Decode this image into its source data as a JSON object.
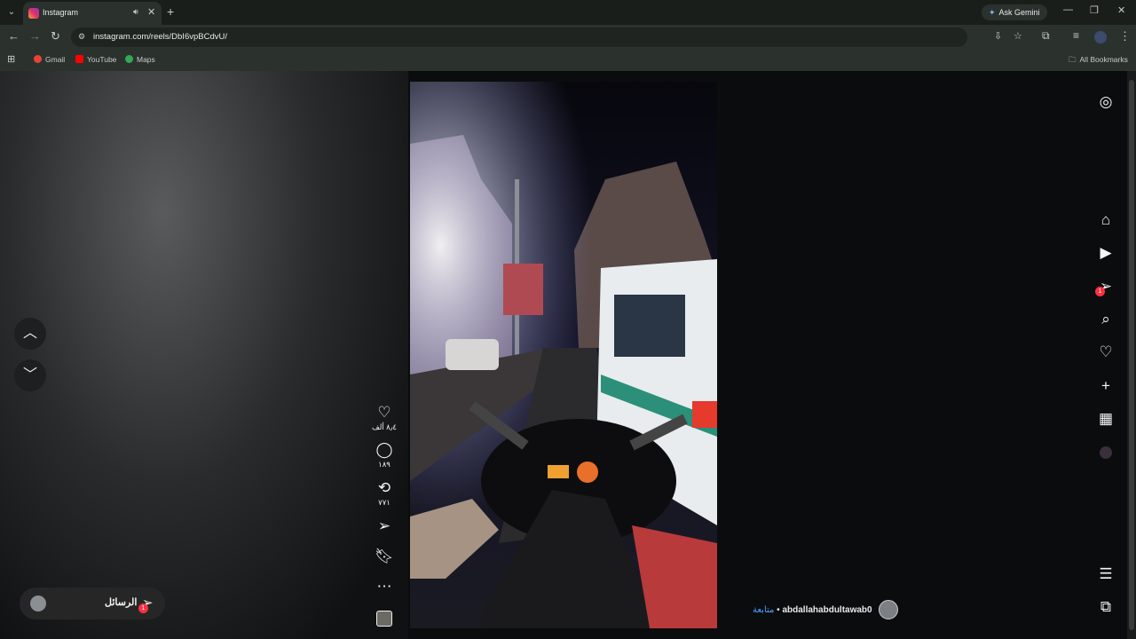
{
  "browser": {
    "tab": {
      "title": "Instagram"
    },
    "gemini_label": "Ask Gemini",
    "url": "instagram.com/reels/DbI6vpBCdvU/",
    "bookmarks": [
      {
        "label": "Gmail",
        "color": "#ea4335"
      },
      {
        "label": "YouTube",
        "color": "#ff0000"
      },
      {
        "label": "Maps",
        "color": "#34a853"
      }
    ],
    "all_bookmarks": "All Bookmarks"
  },
  "reel": {
    "likes": "٨٫٤ ألف",
    "comments": "١٨٩",
    "reposts": "٧٧١",
    "author": "abdallahabdultawab0",
    "follow": "متابعة",
    "separator": "•"
  },
  "messages": {
    "label": "الرسائل",
    "badge": "1"
  },
  "sidebar": {
    "notification_badge": "1"
  },
  "colors": {
    "badge": "#ff3040",
    "follow": "#4aa3ff"
  }
}
